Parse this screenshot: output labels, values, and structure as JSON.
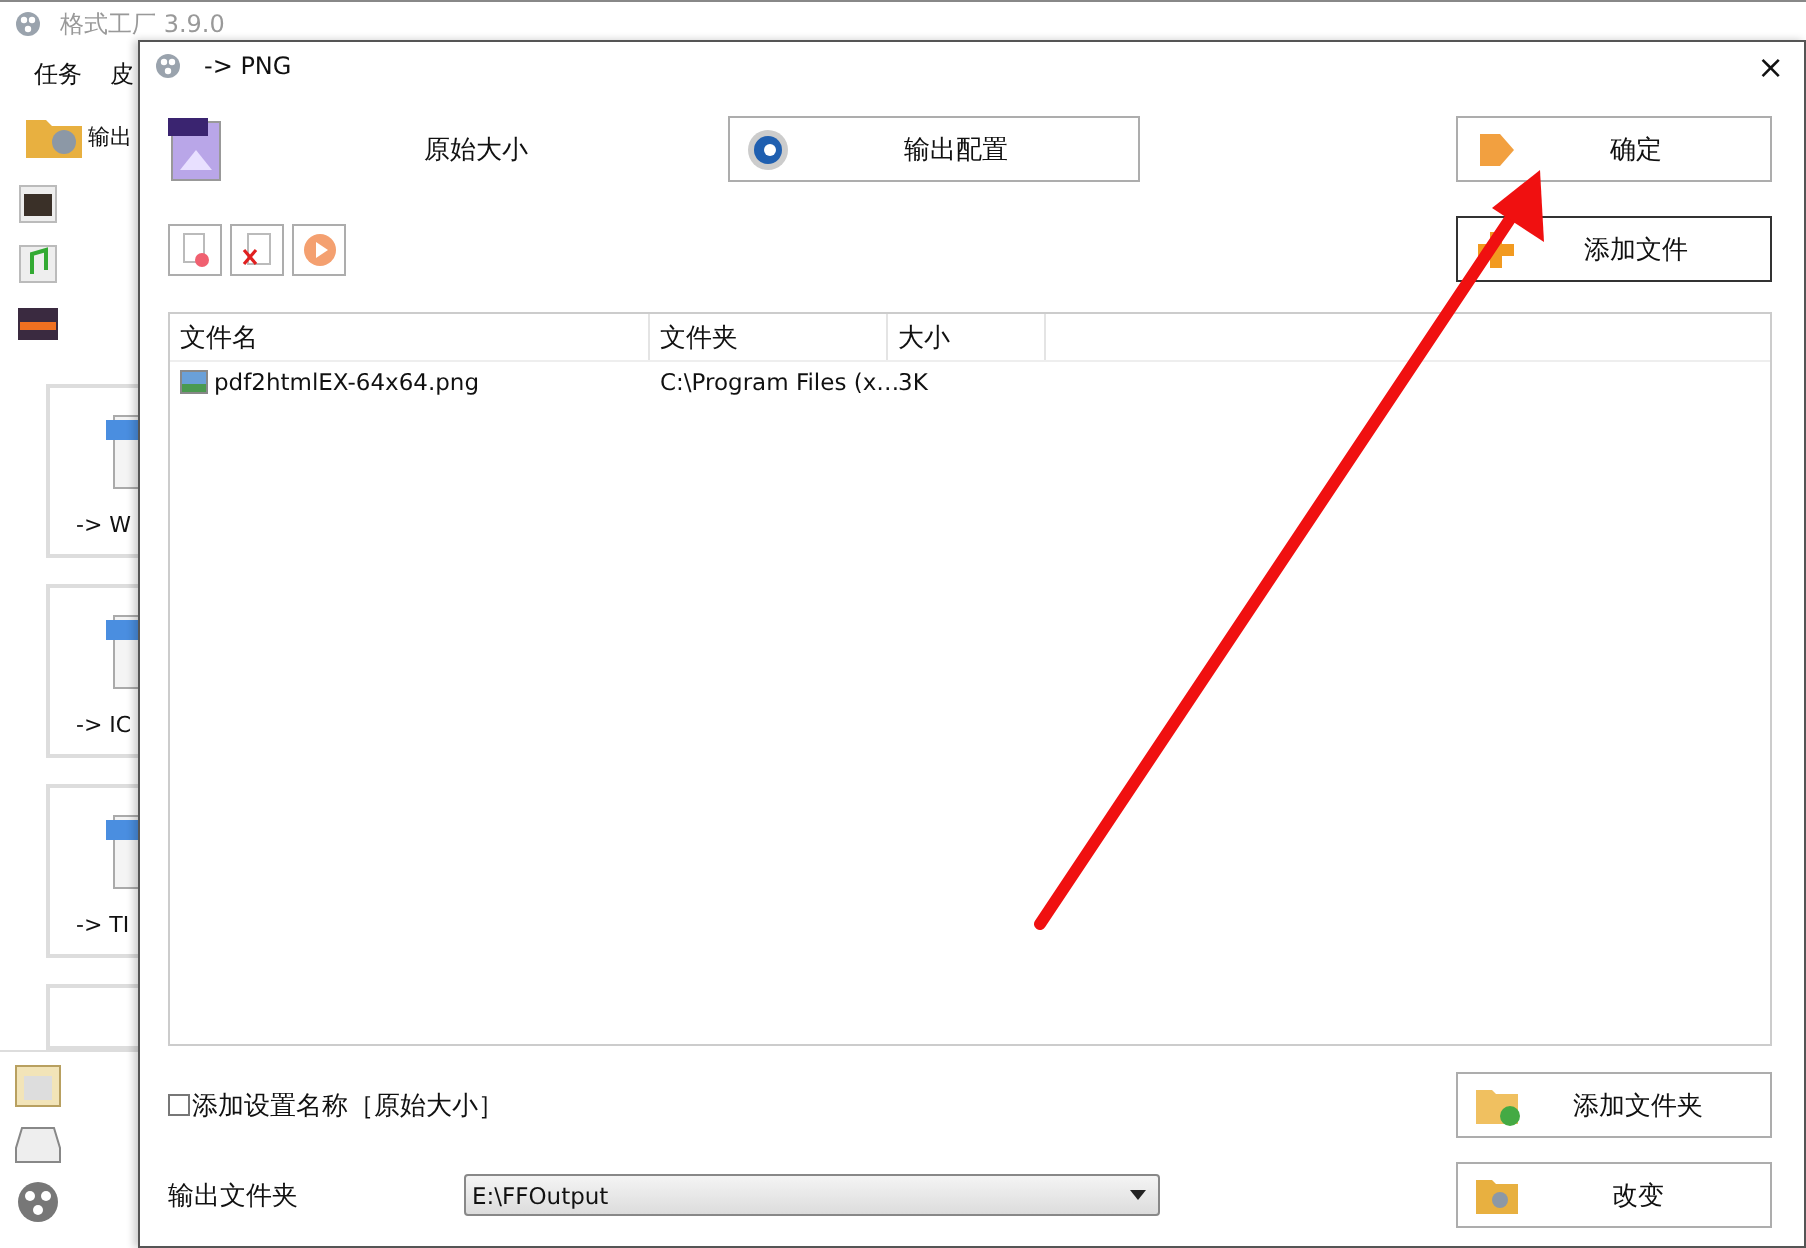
{
  "main_window": {
    "title": "格式工厂 3.9.0",
    "menu": [
      "任务",
      "皮"
    ],
    "toolbar_label": "输出",
    "formats": [
      {
        "label": "-> W"
      },
      {
        "label": "-> IC"
      },
      {
        "label": "-> TI"
      }
    ]
  },
  "dialog": {
    "title": "-> PNG",
    "close": "×",
    "preset": "原始大小",
    "config_button": "输出配置",
    "ok_button": "确定",
    "add_file_button": "添加文件",
    "table": {
      "columns": [
        "文件名",
        "文件夹",
        "大小"
      ],
      "rows": [
        [
          "pdf2htmlEX-64x64.png",
          "C:\\Program Files (x…",
          "3K"
        ]
      ]
    },
    "add_name": {
      "label": "添加设置名称［原始大小］",
      "checked": false
    },
    "add_folder_button": "添加文件夹",
    "output_folder": {
      "label": "输出文件夹",
      "value": "E:\\FFOutput"
    },
    "change_button": "改变"
  }
}
